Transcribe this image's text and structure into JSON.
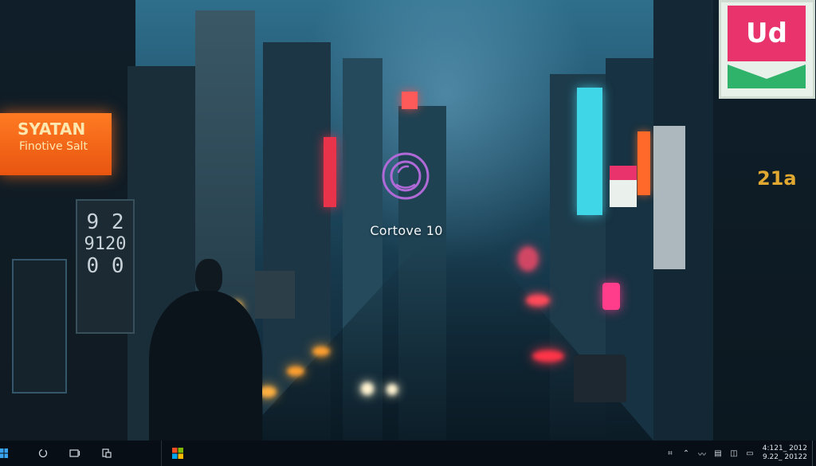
{
  "boot": {
    "title": "Cortove 10"
  },
  "wallpaper": {
    "sign_orange_line1": "SYATAN",
    "sign_orange_line2": "Finotive Salt",
    "sign_green_text": "Ud",
    "sign_numbers_line1": "9 2",
    "sign_numbers_line2": "9120",
    "sign_numbers_line3": "0 0",
    "sign_right_text": "21a"
  },
  "taskbar": {
    "start_icon": "windows-start-icon",
    "search_icon": "search-icon",
    "task_view_icon": "task-view-icon",
    "widget_icon": "widgets-icon",
    "store_icon": "windows-app-icon"
  },
  "tray": {
    "icons": [
      "network-icon",
      "chevron-up-icon",
      "wifi-icon",
      "keyboard-icon",
      "volume-icon",
      "battery-icon"
    ]
  },
  "clock": {
    "time": "4:121_ 2012",
    "date": "9.22_ 20122"
  },
  "colors": {
    "accent": "#b06ad8",
    "orange_sign": "#ff6a1a",
    "pink_sign": "#e8336d",
    "cyan_sign": "#3fd6e8",
    "taskbar": "#080e14"
  }
}
